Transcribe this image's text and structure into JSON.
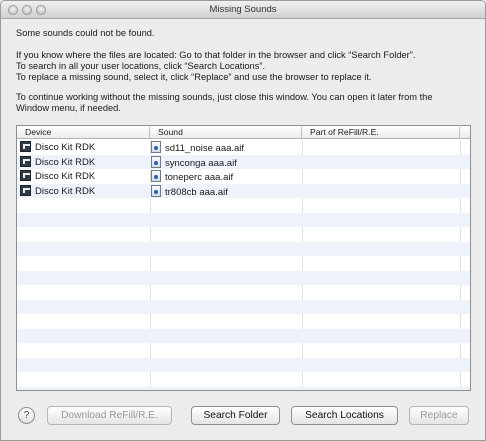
{
  "window": {
    "title": "Missing Sounds"
  },
  "messages": {
    "line1": "Some sounds could not be found.",
    "line2": "If you know where the files are located: Go to that folder in the browser and click “Search Folder”.",
    "line3": "To search in all your user locations, click “Search Locations”.",
    "line4": "To replace a missing sound, select it, click “Replace” and use the browser to replace it.",
    "line5": "To continue working without the missing sounds, just close this window. You can open it later from the",
    "line6": "Window menu, if needed."
  },
  "table": {
    "columns": [
      "Device",
      "Sound",
      "Part of ReFill/R.E."
    ],
    "rows": [
      {
        "device": "Disco Kit RDK",
        "sound": "sd11_noise aaa.aif",
        "part": ""
      },
      {
        "device": "Disco Kit RDK",
        "sound": "synconga aaa.aif",
        "part": ""
      },
      {
        "device": "Disco Kit RDK",
        "sound": "toneperc aaa.aif",
        "part": ""
      },
      {
        "device": "Disco Kit RDK",
        "sound": "tr808cb aaa.aif",
        "part": ""
      }
    ],
    "icons": {
      "device": "device-icon",
      "sound": "sound-file-icon"
    }
  },
  "buttons": {
    "help": "?",
    "download": "Download ReFill/R.E.",
    "search_folder": "Search Folder",
    "search_locations": "Search Locations",
    "replace": "Replace"
  }
}
